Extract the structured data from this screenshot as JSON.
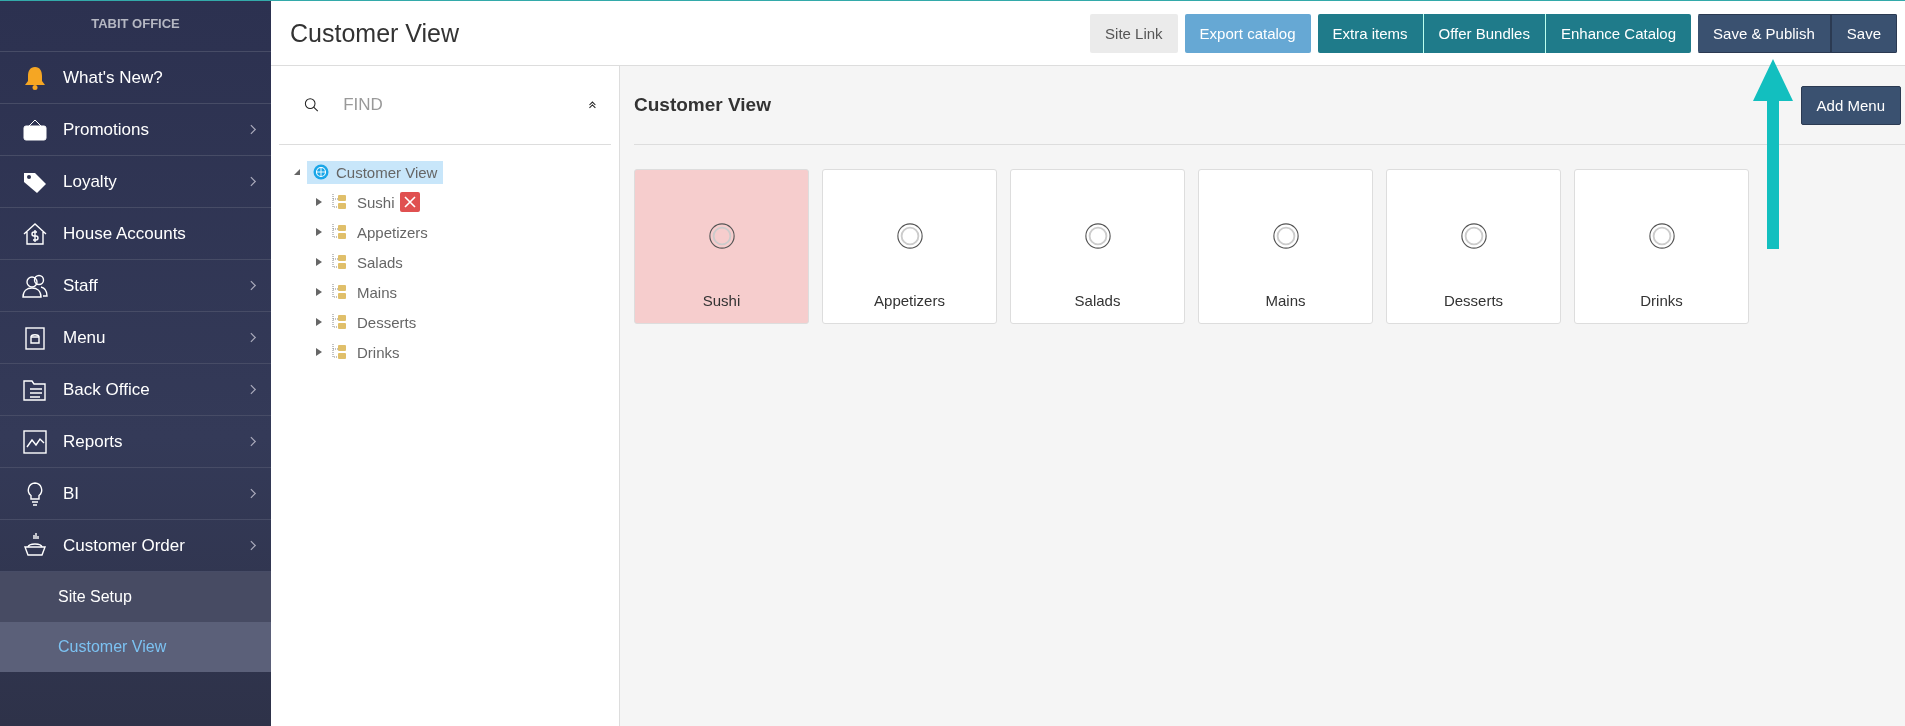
{
  "sidebar": {
    "brand": "TABIT OFFICE",
    "items": [
      {
        "label": "What's New?",
        "has_submenu": false
      },
      {
        "label": "Promotions",
        "has_submenu": true
      },
      {
        "label": "Loyalty",
        "has_submenu": true
      },
      {
        "label": "House Accounts",
        "has_submenu": false
      },
      {
        "label": "Staff",
        "has_submenu": true
      },
      {
        "label": "Menu",
        "has_submenu": true
      },
      {
        "label": "Back Office",
        "has_submenu": true
      },
      {
        "label": "Reports",
        "has_submenu": true
      },
      {
        "label": "BI",
        "has_submenu": true
      },
      {
        "label": "Customer Order",
        "has_submenu": true,
        "children": [
          {
            "label": "Site Setup",
            "selected": false
          },
          {
            "label": "Customer View",
            "selected": true
          }
        ]
      }
    ]
  },
  "header": {
    "title": "Customer View",
    "toolbar": [
      {
        "kind": "plain",
        "buttons": [
          "Site Link"
        ]
      },
      {
        "kind": "light",
        "buttons": [
          "Export catalog"
        ]
      },
      {
        "kind": "teal",
        "buttons": [
          "Extra items",
          "Offer Bundles",
          "Enhance Catalog"
        ]
      },
      {
        "kind": "dark",
        "buttons": [
          "Save & Publish",
          "Save"
        ]
      }
    ]
  },
  "tree": {
    "search": {
      "placeholder": "FIND"
    },
    "root": {
      "label": "Customer View",
      "selected": true,
      "expanded": true,
      "children": [
        {
          "label": "Sushi",
          "error": true,
          "expanded": false
        },
        {
          "label": "Appetizers",
          "error": false,
          "expanded": false
        },
        {
          "label": "Salads",
          "error": false,
          "expanded": false
        },
        {
          "label": "Mains",
          "error": false,
          "expanded": false
        },
        {
          "label": "Desserts",
          "error": false,
          "expanded": false
        },
        {
          "label": "Drinks",
          "error": false,
          "expanded": false
        }
      ]
    }
  },
  "content": {
    "title": "Customer View",
    "add_button": "Add Menu",
    "cards": [
      {
        "label": "Sushi",
        "error": true
      },
      {
        "label": "Appetizers",
        "error": false
      },
      {
        "label": "Salads",
        "error": false
      },
      {
        "label": "Mains",
        "error": false
      },
      {
        "label": "Desserts",
        "error": false
      },
      {
        "label": "Drinks",
        "error": false
      }
    ]
  }
}
